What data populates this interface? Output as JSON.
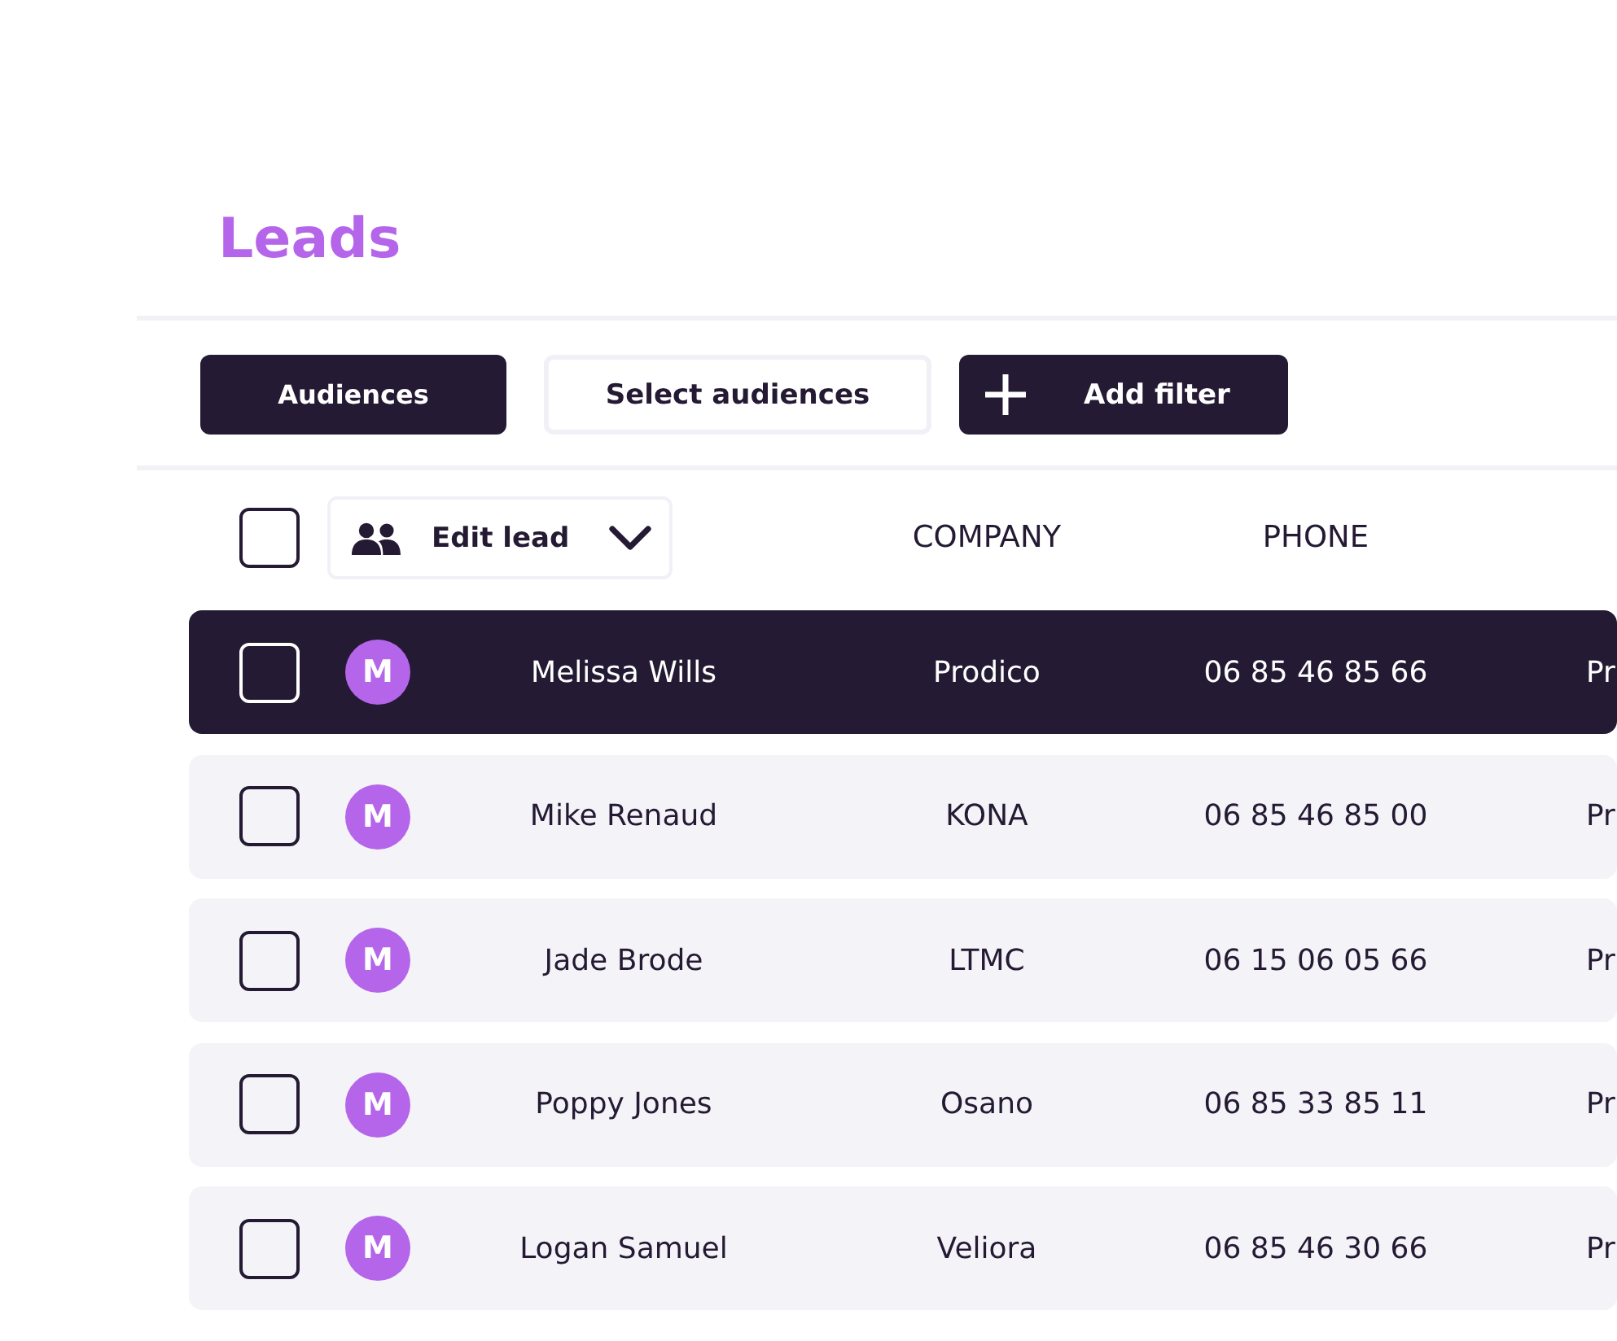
{
  "title": "Leads",
  "toolbar": {
    "buttons": [
      {
        "label": "Audiences",
        "kind": "filled"
      },
      {
        "label": "Select audiences",
        "kind": "outlined"
      },
      {
        "label": "Add filter",
        "kind": "add"
      }
    ]
  },
  "table": {
    "select_all": {
      "checked": false
    },
    "column_menu": {
      "label": "Edit lead"
    },
    "columns": [
      "COMPANY",
      "PHONE"
    ],
    "rows": [
      {
        "selected": true,
        "checked": false,
        "initial": "M",
        "name": "Melissa Wills",
        "company": "Prodico",
        "phone": "06 85 46 85 66",
        "column_5": "Pr"
      },
      {
        "selected": false,
        "checked": false,
        "initial": "M",
        "name": "Mike Renaud",
        "company": "KONA",
        "phone": "06 85 46 85 00",
        "column_5": "Pr"
      },
      {
        "selected": false,
        "checked": false,
        "initial": "M",
        "name": "Jade Brode",
        "company": "LTMC",
        "phone": "06 15 06 05 66",
        "column_5": "Pr"
      },
      {
        "selected": false,
        "checked": false,
        "initial": "M",
        "name": "Poppy Jones",
        "company": "Osano",
        "phone": "06 85 33 85 11",
        "column_5": "Pr"
      },
      {
        "selected": false,
        "checked": false,
        "initial": "M",
        "name": "Logan Samuel",
        "company": "Veliora",
        "phone": "06 85 46 30 66",
        "column_5": "Pr"
      }
    ]
  }
}
